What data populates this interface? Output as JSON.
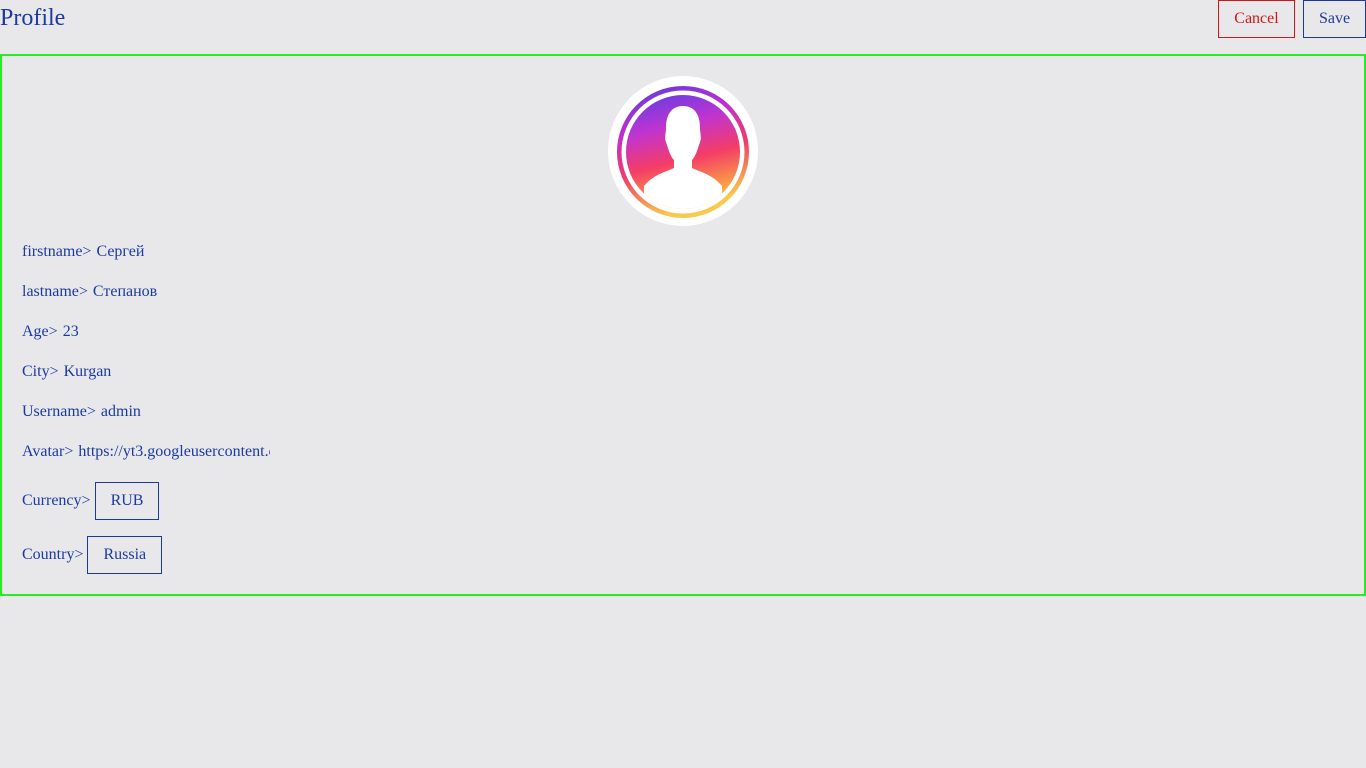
{
  "header": {
    "title": "Profile",
    "cancel_label": "Cancel",
    "save_label": "Save"
  },
  "profile": {
    "avatar_icon": "user-silhouette-icon",
    "fields": {
      "firstname": {
        "label": "firstname>",
        "value": "Сергей"
      },
      "lastname": {
        "label": "lastname>",
        "value": "Степанов"
      },
      "age": {
        "label": "Age>",
        "value": "23"
      },
      "city": {
        "label": "City>",
        "value": "Kurgan"
      },
      "username": {
        "label": "Username>",
        "value": "admin"
      },
      "avatar": {
        "label": "Avatar>",
        "value": "https://yt3.googleusercontent.c"
      },
      "currency": {
        "label": "Currency>",
        "value": "RUB"
      },
      "country": {
        "label": "Country>",
        "value": "Russia"
      }
    }
  },
  "colors": {
    "background": "#e8e8eb",
    "text": "#1a3aa0",
    "cancel": "#d01818",
    "panel_border": "#22ee22"
  }
}
